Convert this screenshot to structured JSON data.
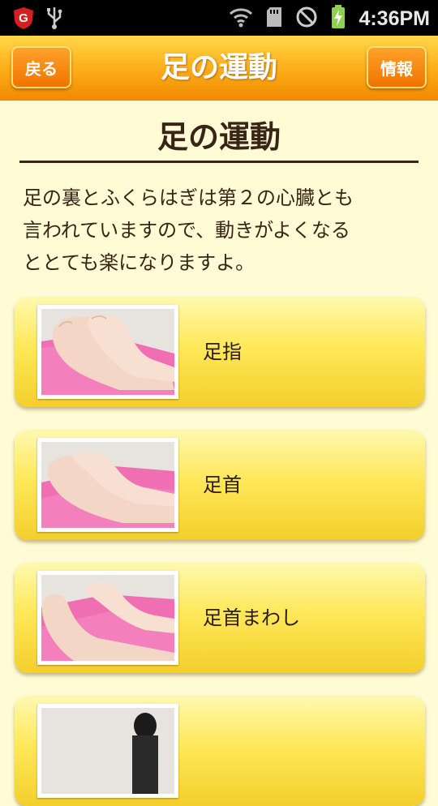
{
  "status_bar": {
    "time": "4:36PM",
    "icons": [
      "g-shield-icon",
      "usb-icon",
      "wifi-icon",
      "sd-card-icon",
      "do-not-disturb-icon",
      "battery-charging-icon"
    ]
  },
  "header": {
    "back_label": "戻る",
    "title": "足の運動",
    "info_label": "情報"
  },
  "page": {
    "title": "足の運動",
    "intro_lines": [
      "足の裏とふくらはぎは第２の心臓とも",
      "言われていますので、動きがよくなる",
      "ととても楽になりますよ。"
    ]
  },
  "exercises": [
    {
      "label": "足指",
      "image": "feet-toes-photo"
    },
    {
      "label": "足首",
      "image": "feet-ankle-photo"
    },
    {
      "label": "足首まわし",
      "image": "feet-ankle-rotation-photo"
    },
    {
      "label": "",
      "image": "person-photo"
    }
  ],
  "colors": {
    "header_orange": "#f08a00",
    "background": "#fffbd4",
    "card_yellow": "#ffe85a",
    "text_brown": "#3a2418"
  }
}
